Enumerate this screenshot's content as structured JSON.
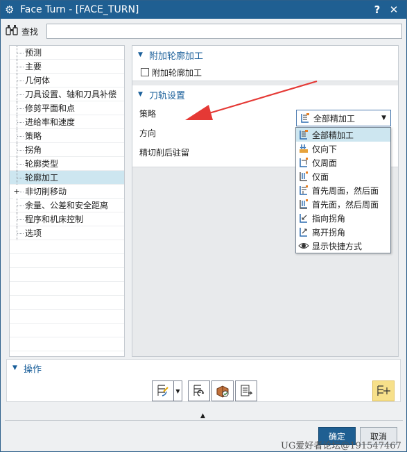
{
  "window": {
    "title": "Face Turn - [FACE_TURN]",
    "help_label": "?",
    "close_label": "✕"
  },
  "search": {
    "label": "查找",
    "value": ""
  },
  "nav": {
    "items": [
      {
        "label": "预测"
      },
      {
        "label": "主要"
      },
      {
        "label": "几何体"
      },
      {
        "label": "刀具设置、轴和刀具补偿"
      },
      {
        "label": "修剪平面和点"
      },
      {
        "label": "进给率和速度"
      },
      {
        "label": "策略"
      },
      {
        "label": "拐角"
      },
      {
        "label": "轮廓类型"
      },
      {
        "label": "轮廓加工",
        "selected": true
      },
      {
        "label": "非切削移动",
        "expandable": true,
        "expander": "+"
      },
      {
        "label": "余量、公差和安全距离"
      },
      {
        "label": "程序和机床控制"
      },
      {
        "label": "选项"
      }
    ]
  },
  "sections": {
    "additional_contour": {
      "title": "附加轮廓加工",
      "checkbox_label": "附加轮廓加工",
      "checked": false
    },
    "path_settings": {
      "title": "刀轨设置",
      "fields": [
        {
          "label": "策略"
        },
        {
          "label": "方向"
        },
        {
          "label": "精切削后驻留"
        }
      ]
    }
  },
  "strategy_dropdown": {
    "selected": "全部精加工",
    "options": [
      {
        "label": "全部精加工",
        "icon": "finish-all-icon",
        "selected": true
      },
      {
        "label": "仅向下",
        "icon": "down-only-icon"
      },
      {
        "label": "仅周面",
        "icon": "perimeter-only-icon"
      },
      {
        "label": "仅面",
        "icon": "face-only-icon"
      },
      {
        "label": "首先周面，然后面",
        "icon": "perimeter-then-face-icon"
      },
      {
        "label": "首先面，然后周面",
        "icon": "face-then-perimeter-icon"
      },
      {
        "label": "指向拐角",
        "icon": "toward-corner-icon"
      },
      {
        "label": "离开拐角",
        "icon": "away-from-corner-icon"
      },
      {
        "label": "显示快捷方式",
        "icon": "eye-icon"
      }
    ]
  },
  "operations": {
    "title": "操作"
  },
  "buttons": {
    "ok": "确定",
    "cancel": "取消"
  },
  "watermark": "UG爱好者论坛@191547467",
  "colors": {
    "title_bar": "#1f5f92",
    "accent_text": "#1a5f9a",
    "selection": "#cde6f0",
    "arrow": "#e53935",
    "highlight_tool": "#f7e08a"
  }
}
